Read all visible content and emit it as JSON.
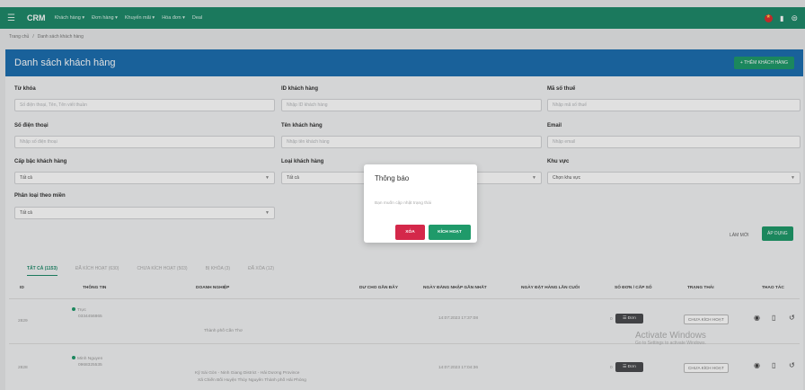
{
  "topbar": {
    "brand": "CRM",
    "nav": [
      "Khách hàng ▾",
      "Đơn hàng ▾",
      "Khuyến mãi ▾",
      "Hóa đơn ▾",
      "Deal"
    ]
  },
  "breadcrumb": [
    "Trang chủ",
    "/",
    "Danh sách khách hàng"
  ],
  "card": {
    "title": "Danh sách khách hàng",
    "add_label": "+ THÊM KHÁCH HÀNG"
  },
  "filters": {
    "keyword": {
      "label": "Từ khóa",
      "placeholder": "Số điện thoại, Tên, Tên viết thuần"
    },
    "customer_id": {
      "label": "ID khách hàng",
      "placeholder": "Nhập ID khách hàng"
    },
    "tax_code": {
      "label": "Mã số thuế",
      "placeholder": "Nhập mã số thuế"
    },
    "phone": {
      "label": "Số điện thoại",
      "placeholder": "Nhập số điện thoại"
    },
    "customer_name": {
      "label": "Tên khách hàng",
      "placeholder": "Nhập tên khách hàng"
    },
    "email": {
      "label": "Email",
      "placeholder": "Nhập email"
    },
    "tier": {
      "label": "Cấp bậc khách hàng",
      "value": "Tất cả"
    },
    "type": {
      "label": "Loại khách hàng",
      "value": "Tất cả"
    },
    "region": {
      "label": "Khu vực",
      "placeholder": "Chọn khu vực"
    },
    "area": {
      "label": "Phân loại theo miền",
      "value": "Tất cả"
    },
    "reset_label": "LÀM MỚI",
    "apply_label": "ÁP DỤNG"
  },
  "tabs": [
    "TẤT CẢ (1153)",
    "ĐÃ KÍCH HOẠT (630)",
    "CHƯA KÍCH HOẠT (503)",
    "BỊ KHÓA (3)",
    "ĐÃ XÓA (12)"
  ],
  "table": {
    "headers": [
      "ID",
      "THÔNG TIN",
      "DOANH NGHIỆP",
      "DƯ CHO GẦN ĐÂY",
      "NGÀY ĐĂNG NHẬP GẦN NHẤT",
      "NGÀY ĐẶT HÀNG LẦN CUỐI",
      "SỐ ĐƠN / CẤP SỐ",
      "TRẠNG THÁI",
      "THAO TÁC"
    ],
    "rows": [
      {
        "id": "2829",
        "name": "Trực",
        "phone": "0334456865",
        "company": "",
        "address": "Thành phố Cần Thơ",
        "last_login": "14:07:2023 17:37:08",
        "orders": "0",
        "order_btn": "☰ Đơn",
        "status": "CHƯA KÍCH HOẠT"
      },
      {
        "id": "2828",
        "name": "Minh Nguyen",
        "phone": "0968325535",
        "company": "Kỹ Sài Gòn - Ninh Giang District - Hải Dương Province",
        "address": "Xã Chiến Bối Huyện Thủy Nguyên Thành phố Hải Phòng",
        "last_login": "14:07:2023 17:04:36",
        "orders": "0",
        "order_btn": "☰ Đơn",
        "status": "CHƯA KÍCH HOẠT"
      }
    ]
  },
  "modal": {
    "title": "Thông báo",
    "message": "Bạn muốn cập nhật trạng thái",
    "delete_label": "XÓA",
    "activate_label": "KÍCH HOẠT"
  },
  "watermark": {
    "line1": "Activate Windows",
    "line2": "Go to Settings to activate Windows."
  }
}
